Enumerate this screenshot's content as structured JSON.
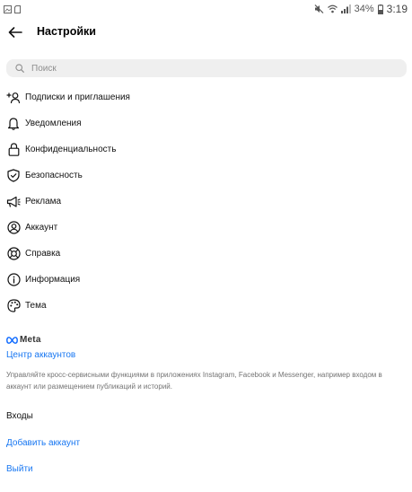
{
  "status_bar": {
    "left_icons": [
      "gallery-icon",
      "sd-card-icon"
    ],
    "battery": "34%",
    "time": "3:19"
  },
  "header": {
    "title": "Настройки"
  },
  "search": {
    "placeholder": "Поиск"
  },
  "menu": [
    {
      "label": "Подписки и приглашения",
      "icon": "add-person-icon"
    },
    {
      "label": "Уведомления",
      "icon": "bell-icon"
    },
    {
      "label": "Конфиденциальность",
      "icon": "lock-icon"
    },
    {
      "label": "Безопасность",
      "icon": "shield-icon"
    },
    {
      "label": "Реклама",
      "icon": "megaphone-icon"
    },
    {
      "label": "Аккаунт",
      "icon": "account-icon"
    },
    {
      "label": "Справка",
      "icon": "lifebuoy-icon"
    },
    {
      "label": "Информация",
      "icon": "info-icon"
    },
    {
      "label": "Тема",
      "icon": "palette-icon"
    }
  ],
  "meta": {
    "logo_text": "Meta",
    "accounts_center": "Центр аккаунтов",
    "description": "Управляйте кросс-сервисными функциями в приложениях Instagram, Facebook и Messenger, например входом в аккаунт или размещением публикаций и историй."
  },
  "logins": {
    "title": "Входы",
    "add_account": "Добавить аккаунт",
    "logout": "Выйти"
  },
  "colors": {
    "link": "#1877f2",
    "search_bg": "#efefef",
    "secondary_text": "#737373"
  }
}
